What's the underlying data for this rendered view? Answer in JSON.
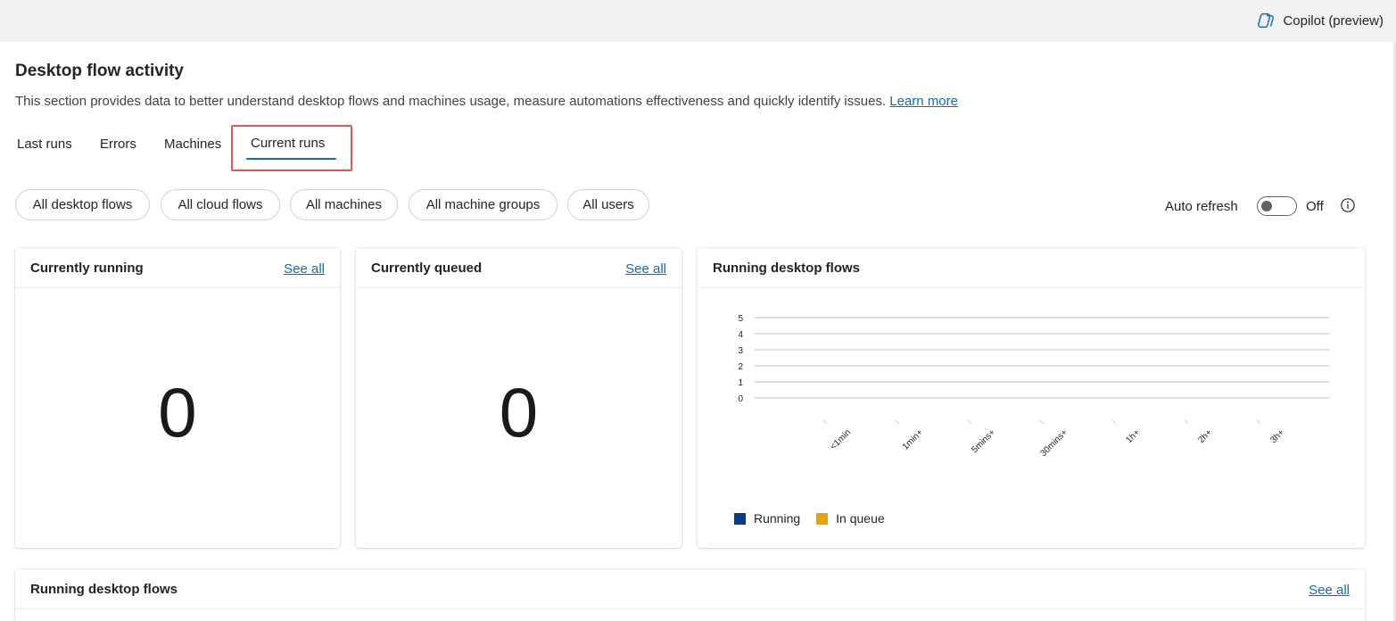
{
  "topbar": {
    "copilot_label": "Copilot (preview)"
  },
  "page": {
    "title": "Desktop flow activity",
    "description": "This section provides data to better understand desktop flows and machines usage, measure automations effectiveness and quickly identify issues.",
    "learn_more": "Learn more"
  },
  "tabs": [
    {
      "label": "Last runs",
      "active": false
    },
    {
      "label": "Errors",
      "active": false
    },
    {
      "label": "Machines",
      "active": false
    },
    {
      "label": "Current runs",
      "active": true
    }
  ],
  "filters": [
    "All desktop flows",
    "All cloud flows",
    "All machines",
    "All machine groups",
    "All users"
  ],
  "auto_refresh": {
    "label": "Auto refresh",
    "state": "Off",
    "enabled": false
  },
  "cards": {
    "currently_running": {
      "title": "Currently running",
      "see_all": "See all",
      "value": "0"
    },
    "currently_queued": {
      "title": "Currently queued",
      "see_all": "See all",
      "value": "0"
    },
    "running_chart": {
      "title": "Running desktop flows"
    },
    "running_table": {
      "title": "Running desktop flows",
      "see_all": "See all"
    }
  },
  "colors": {
    "accent": "#0f6cbd",
    "running": "#0a3b8c",
    "in_queue": "#e8a202",
    "highlight": "#e05a5a"
  },
  "chart_data": {
    "type": "bar",
    "title": "Running desktop flows",
    "categories": [
      "<1min",
      "1min+",
      "5mins+",
      "30mins+",
      "1h+",
      "2h+",
      "3h+"
    ],
    "series": [
      {
        "name": "Running",
        "values": [
          0,
          0,
          0,
          0,
          0,
          0,
          0
        ]
      },
      {
        "name": "In queue",
        "values": [
          0,
          0,
          0,
          0,
          0,
          0,
          0
        ]
      }
    ],
    "yticks": [
      "0",
      "1",
      "2",
      "3",
      "4",
      "5"
    ],
    "ylim": [
      0,
      5
    ],
    "grid": true,
    "legend": "bottom-left"
  }
}
